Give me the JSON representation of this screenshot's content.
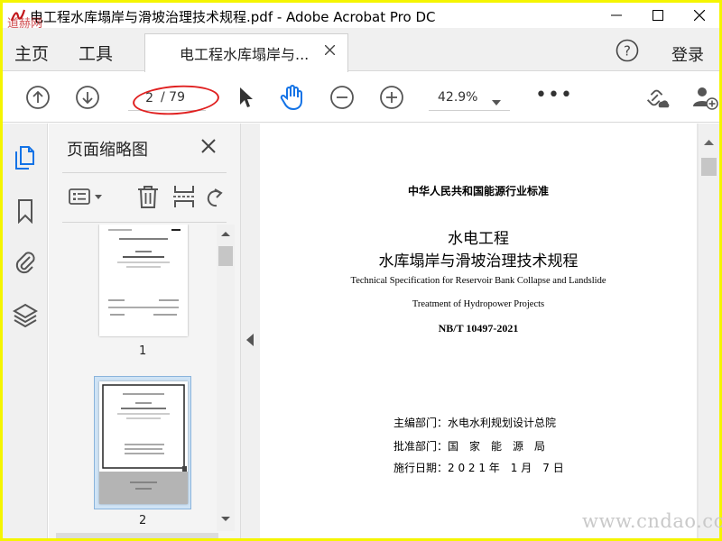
{
  "window": {
    "title": "电工程水库塌岸与滑坡治理技术规程.pdf - Adobe Acrobat Pro DC",
    "logo_text": "道赫网"
  },
  "menu": {
    "home": "主页",
    "tools": "工具",
    "doc_tab": "电工程水库塌岸与...",
    "login": "登录"
  },
  "toolbar": {
    "page_input": "2",
    "page_total": "/ 79",
    "zoom": "42.9%",
    "more": "•••"
  },
  "panel": {
    "title": "页面缩略图",
    "thumbnails": [
      {
        "number": "1",
        "lines": [
          "中华人民共和国能源行业标准",
          "水电工程",
          "水库塌岸与滑坡治理技术规程",
          "Technical Specification for Reservoir Bank Collapse",
          "Treatment of Hydropower Projects",
          "2021-01-07发布",
          "2021-07-01实施",
          "国家能源局 发布"
        ]
      },
      {
        "number": "2",
        "lines": [
          "中华人民共和国能源行业标准",
          "水电工程",
          "水库塌岸与滑坡治理技术规程",
          "Technical Specification for Reservoir Bank Collapse",
          "Treatment of Hydropower Projects",
          "主编部门：水电水利规划设计总院",
          "批准部门：国家能源局",
          "施行日期：2021年1月7日",
          "中国水利水电出版社",
          "2021 北京"
        ]
      }
    ]
  },
  "document": {
    "category": "中华人民共和国能源行业标准",
    "title_line1": "水电工程",
    "title_line2": "水库塌岸与滑坡治理技术规程",
    "en_line1": "Technical Specification for Reservoir Bank Collapse and Landslide",
    "en_line2": "Treatment of Hydropower Projects",
    "code": "NB/T 10497-2021",
    "editor": "主编部门：水电水利规划设计总院",
    "approver": "批准部门：国　家　能　源　局",
    "date": "施行日期：2 0 2 1 年　1 月　7 日"
  },
  "watermark": "www.cndao.com",
  "colors": {
    "frame": "#f5f500",
    "accent_blue": "#1473e6",
    "annotation_red": "#e02020"
  },
  "icons": [
    "app-logo-icon",
    "minimize-icon",
    "maximize-icon",
    "close-icon",
    "help-icon",
    "page-up-icon",
    "page-down-icon",
    "select-arrow-icon",
    "hand-tool-icon",
    "zoom-out-icon",
    "zoom-in-icon",
    "share-link-icon",
    "add-user-icon",
    "page-thumbnails-icon",
    "bookmark-icon",
    "attachment-icon",
    "layers-icon",
    "thumbnail-options-icon",
    "delete-icon",
    "insert-page-icon",
    "rotate-icon",
    "collapse-panel-icon"
  ]
}
